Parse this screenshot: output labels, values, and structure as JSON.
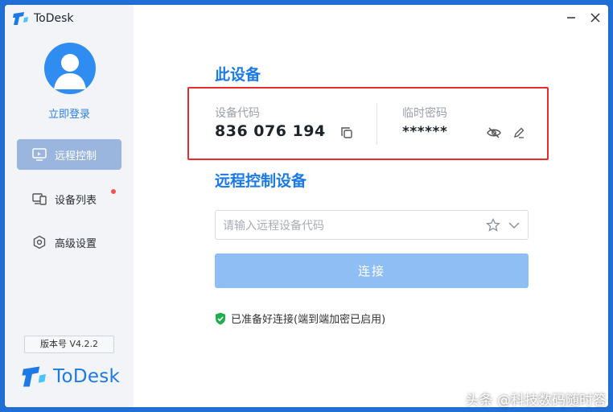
{
  "app": {
    "title": "ToDesk",
    "brand_color": "#1b7ae6"
  },
  "sidebar": {
    "login_label": "立即登录",
    "items": [
      {
        "label": "远程控制",
        "icon": "remote-control-icon",
        "active": true
      },
      {
        "label": "设备列表",
        "icon": "device-list-icon",
        "badge": true
      },
      {
        "label": "高级设置",
        "icon": "settings-icon"
      }
    ],
    "version": "版本号 V4.2.2",
    "logo_text": "ToDesk"
  },
  "this_device": {
    "title": "此设备",
    "code_label": "设备代码",
    "code_value": "836 076 194",
    "password_label": "临时密码",
    "password_value": "******"
  },
  "remote": {
    "title": "远程控制设备",
    "placeholder": "请输入远程设备代码",
    "connect_label": "连接",
    "status_text": "已准备好连接(端到端加密已启用)"
  },
  "watermark": "头条 @科技数码随时答"
}
